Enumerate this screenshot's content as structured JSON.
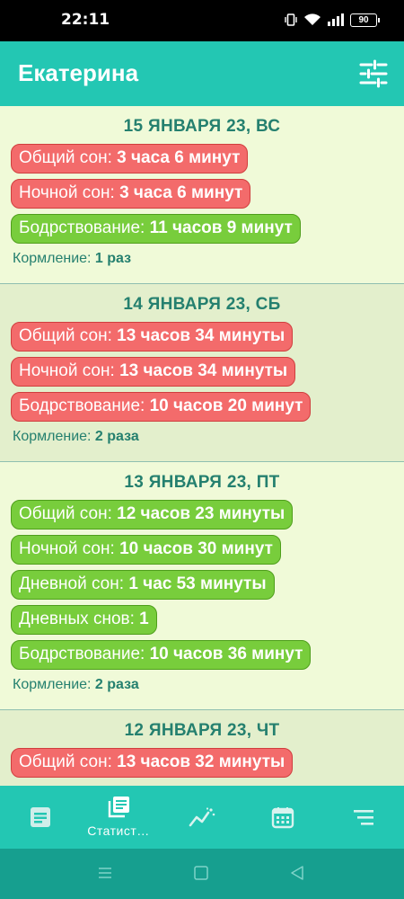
{
  "status": {
    "time": "22:11",
    "battery": "90"
  },
  "header": {
    "title": "Екатерина"
  },
  "days": [
    {
      "date": "15 ЯНВАРЯ 23, ВС",
      "items": [
        {
          "label": "Общий сон: ",
          "value": "3 часа 6 минут",
          "color": "red"
        },
        {
          "label": "Ночной сон: ",
          "value": "3 часа 6 минут",
          "color": "red"
        },
        {
          "label": "Бодрствование: ",
          "value": "11 часов 9 минут",
          "color": "green"
        }
      ],
      "feeding_label": "Кормление: ",
      "feeding_value": "1 раз"
    },
    {
      "date": "14 ЯНВАРЯ 23, СБ",
      "items": [
        {
          "label": "Общий сон: ",
          "value": "13 часов 34 минуты",
          "color": "red"
        },
        {
          "label": "Ночной сон: ",
          "value": "13 часов 34 минуты",
          "color": "red"
        },
        {
          "label": "Бодрствование: ",
          "value": "10 часов 20 минут",
          "color": "red"
        }
      ],
      "feeding_label": "Кормление: ",
      "feeding_value": "2 раза"
    },
    {
      "date": "13 ЯНВАРЯ 23, ПТ",
      "items": [
        {
          "label": "Общий сон: ",
          "value": "12 часов 23 минуты",
          "color": "green"
        },
        {
          "label": "Ночной сон: ",
          "value": "10 часов 30 минут",
          "color": "green"
        },
        {
          "label": "Дневной сон: ",
          "value": "1 час 53 минуты",
          "color": "green"
        },
        {
          "label": "Дневных снов: ",
          "value": "1",
          "color": "green"
        },
        {
          "label": "Бодрствование: ",
          "value": "10 часов 36 минут",
          "color": "green"
        }
      ],
      "feeding_label": "Кормление: ",
      "feeding_value": "2 раза"
    },
    {
      "date": "12 ЯНВАРЯ 23, ЧТ",
      "items": [
        {
          "label": "Общий сон: ",
          "value": "13 часов 32 минуты",
          "color": "red"
        }
      ],
      "feeding_label": "",
      "feeding_value": ""
    }
  ],
  "nav": {
    "items": [
      {
        "icon": "journal-icon",
        "label": ""
      },
      {
        "icon": "statistics-icon",
        "label": "Статист…"
      },
      {
        "icon": "chart-icon",
        "label": ""
      },
      {
        "icon": "calendar-icon",
        "label": ""
      },
      {
        "icon": "menu-icon",
        "label": ""
      }
    ],
    "active": 1
  },
  "colors": {
    "accent": "#23c7b3",
    "red_pill": "#f36b6b",
    "green_pill": "#78cd3c",
    "date_text": "#25806f"
  }
}
